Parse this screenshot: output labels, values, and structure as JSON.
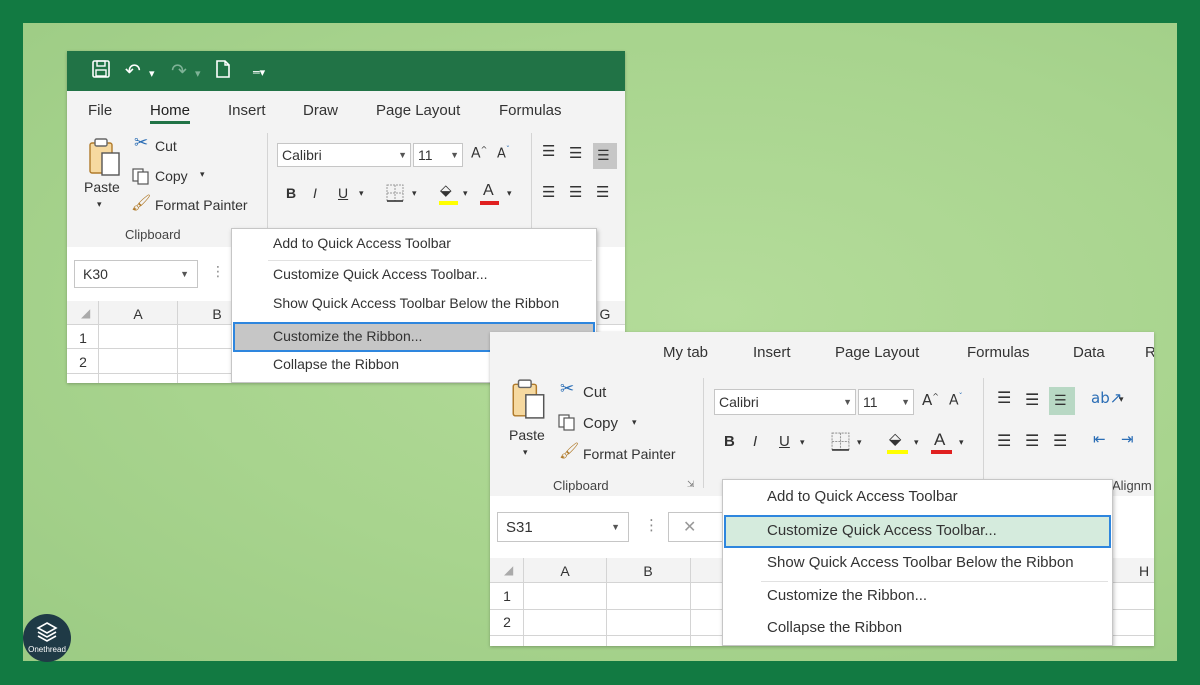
{
  "brand": {
    "logo_text": "Onethread"
  },
  "colors": {
    "frame_border": "#127a42",
    "frame_fill": "#a8d48e",
    "excel_green": "#217346",
    "highlight_blue": "#2e86de",
    "menu_gray_sel": "#c6c6c6",
    "menu_green_sel": "#d5ebdd"
  },
  "shot1": {
    "qat_icons": [
      "save-icon",
      "undo-icon",
      "redo-icon",
      "new-document-icon",
      "customize-qat-icon"
    ],
    "tabs": [
      "File",
      "Home",
      "Insert",
      "Draw",
      "Page Layout",
      "Formulas"
    ],
    "active_tab": "Home",
    "clipboard": {
      "paste": "Paste",
      "cut": "Cut",
      "copy": "Copy",
      "format_painter": "Format Painter",
      "group_label": "Clipboard"
    },
    "font": {
      "name": "Calibri",
      "size": "11",
      "bold": "B",
      "italic": "I",
      "underline": "U",
      "font_color": "A"
    },
    "name_box": "K30",
    "columns": [
      "A",
      "B"
    ],
    "col_g": "G",
    "rows": [
      "1",
      "2"
    ],
    "menu": [
      "Add to Quick Access Toolbar",
      "Customize Quick Access Toolbar...",
      "Show Quick Access Toolbar Below the Ribbon",
      "Customize the Ribbon...",
      "Collapse the Ribbon"
    ],
    "menu_selected": "Customize the Ribbon..."
  },
  "shot2": {
    "tabs": [
      "My tab",
      "Insert",
      "Page Layout",
      "Formulas",
      "Data",
      "R"
    ],
    "clipboard": {
      "paste": "Paste",
      "cut": "Cut",
      "copy": "Copy",
      "format_painter": "Format Painter",
      "group_label": "Clipboard"
    },
    "font": {
      "name": "Calibri",
      "size": "11",
      "bold": "B",
      "italic": "I",
      "underline": "U",
      "font_color": "A"
    },
    "alignment_label": "Alignm",
    "name_box": "S31",
    "columns": [
      "A",
      "B"
    ],
    "col_h": "H",
    "rows": [
      "1",
      "2"
    ],
    "menu": [
      "Add to Quick Access Toolbar",
      "Customize Quick Access Toolbar...",
      "Show Quick Access Toolbar Below the Ribbon",
      "Customize the Ribbon...",
      "Collapse the Ribbon"
    ],
    "menu_selected": "Customize Quick Access Toolbar..."
  }
}
